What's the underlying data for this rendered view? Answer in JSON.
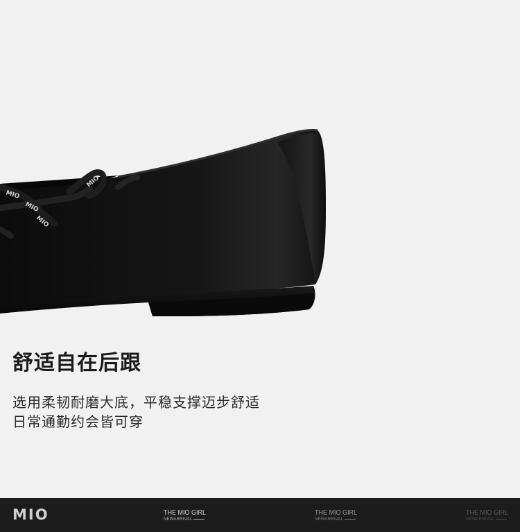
{
  "headline": "舒适自在后跟",
  "description": {
    "line1": "选用柔韧耐磨大底，平稳支撑迈步舒适",
    "line2": "日常通勤约会皆可穿"
  },
  "product_image": {
    "lace_print": "MIO"
  },
  "footer": {
    "brand": "MIO",
    "taglines": [
      {
        "title": "THE MIO GIRL",
        "sub": "NEWARRIVAL"
      },
      {
        "title": "THE MIO GIRL",
        "sub": "NEWARRIVAL"
      },
      {
        "title": "THE MIO GIRL",
        "sub": "NEWARRIVAL"
      }
    ]
  },
  "colors": {
    "background": "#f1f1f1",
    "footer_bg": "#1c1c1c",
    "shoe": "#111111",
    "text": "#1b1b1b"
  }
}
